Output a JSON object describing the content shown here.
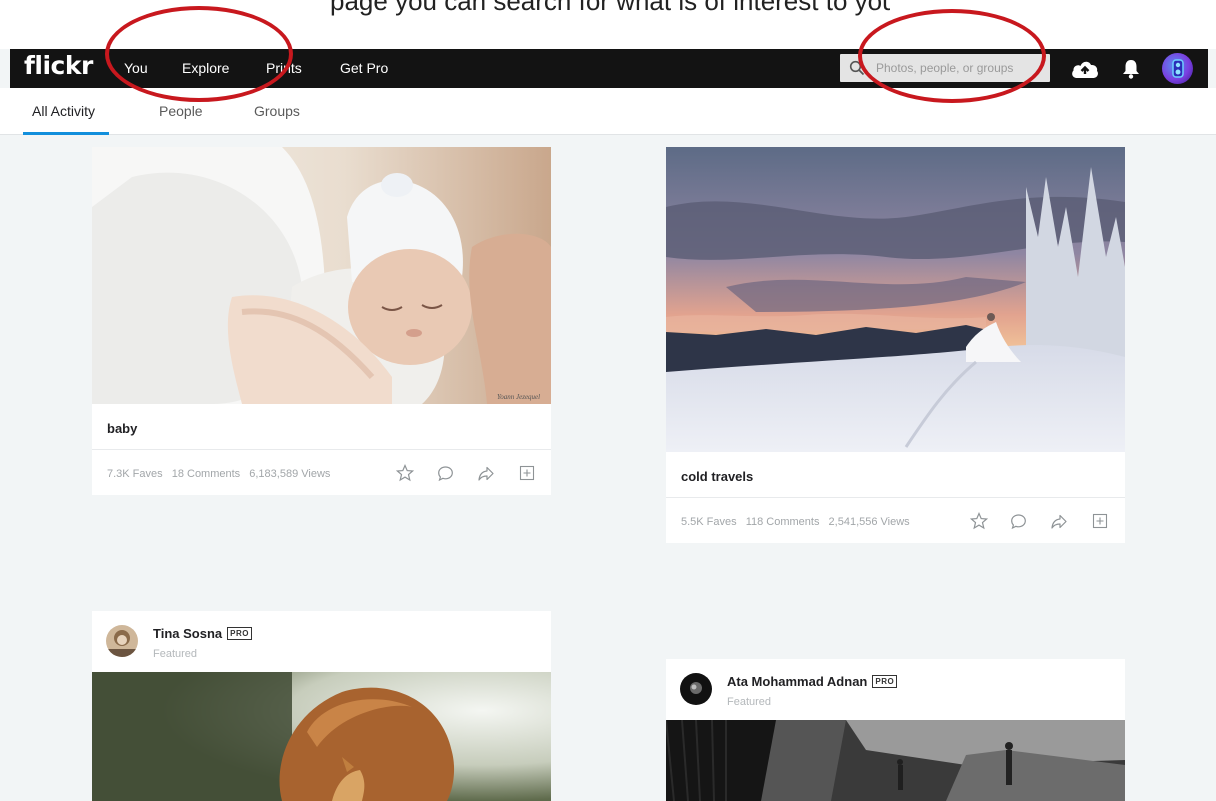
{
  "page_heading_cropped": "page you can search for what is of interest to you",
  "navbar": {
    "logo": "flickr",
    "links": [
      "You",
      "Explore",
      "Prints",
      "Get Pro"
    ],
    "search_placeholder": "Photos, people, or groups",
    "icons": [
      "upload-cloud-icon",
      "bell-icon",
      "user-avatar"
    ]
  },
  "subnav": {
    "tabs": [
      "All Activity",
      "People",
      "Groups"
    ],
    "active_tab": "All Activity"
  },
  "colors": {
    "navbar_bg": "#131313",
    "active_tab_underline": "#128fdc",
    "annotation": "#c8181e",
    "page_bg": "#f2f5f6"
  },
  "feed": {
    "cards": [
      {
        "title": "baby",
        "watermark": "Yoann Jezequel",
        "faves": "7.3K Faves",
        "comments": "18 Comments",
        "views": "6,183,589 Views"
      },
      {
        "title": "cold travels",
        "faves": "5.5K Faves",
        "comments": "118 Comments",
        "views": "2,541,556 Views"
      },
      {
        "author": "Tina Sosna",
        "badge": "PRO",
        "label": "Featured"
      },
      {
        "author": "Ata Mohammad Adnan",
        "badge": "PRO",
        "label": "Featured"
      }
    ],
    "actions": [
      "star-icon",
      "comment-icon",
      "share-icon",
      "add-to-gallery-icon"
    ]
  }
}
